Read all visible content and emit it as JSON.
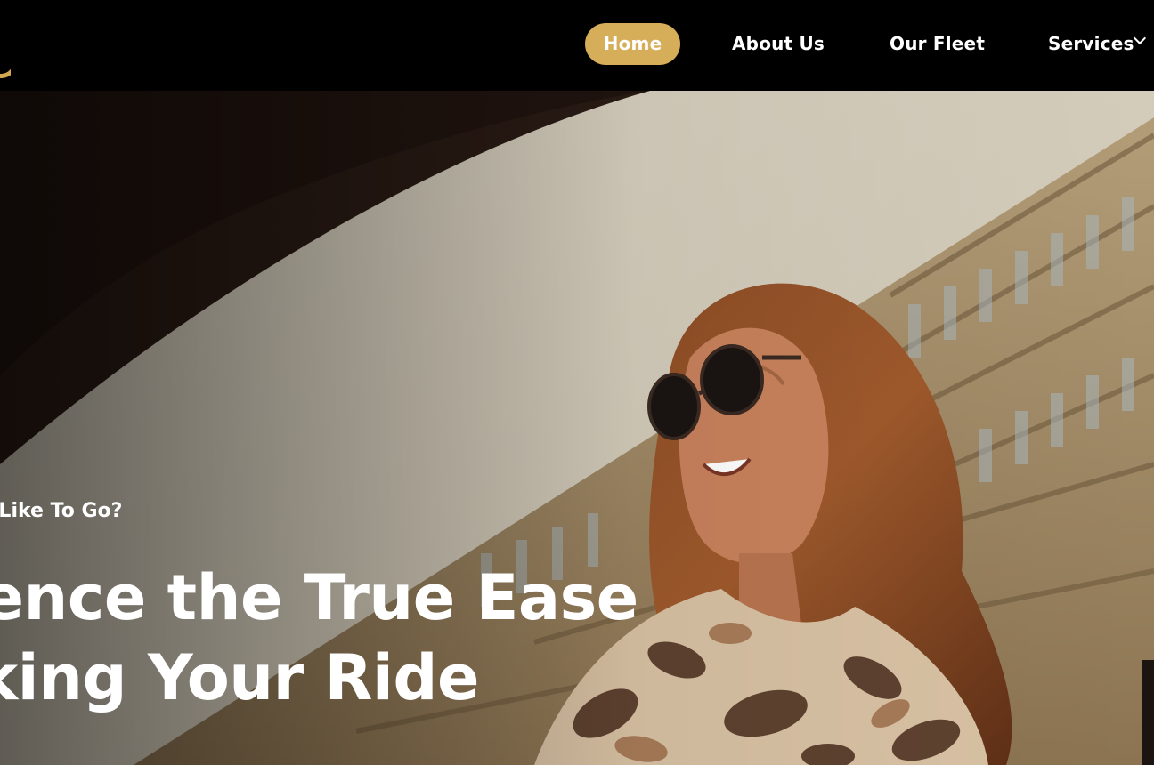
{
  "nav": {
    "logo_icon": "logo-icon",
    "items": [
      {
        "label": "Home",
        "active": true
      },
      {
        "label": "About Us"
      },
      {
        "label": "Our Fleet"
      },
      {
        "label": "Services",
        "has_dropdown": true
      }
    ],
    "active_color": "#d6ad58"
  },
  "hero": {
    "eyebrow": "ou Like To Go?",
    "headline_line1": "rience the True Ease",
    "headline_line2": "oking Your Ride"
  }
}
